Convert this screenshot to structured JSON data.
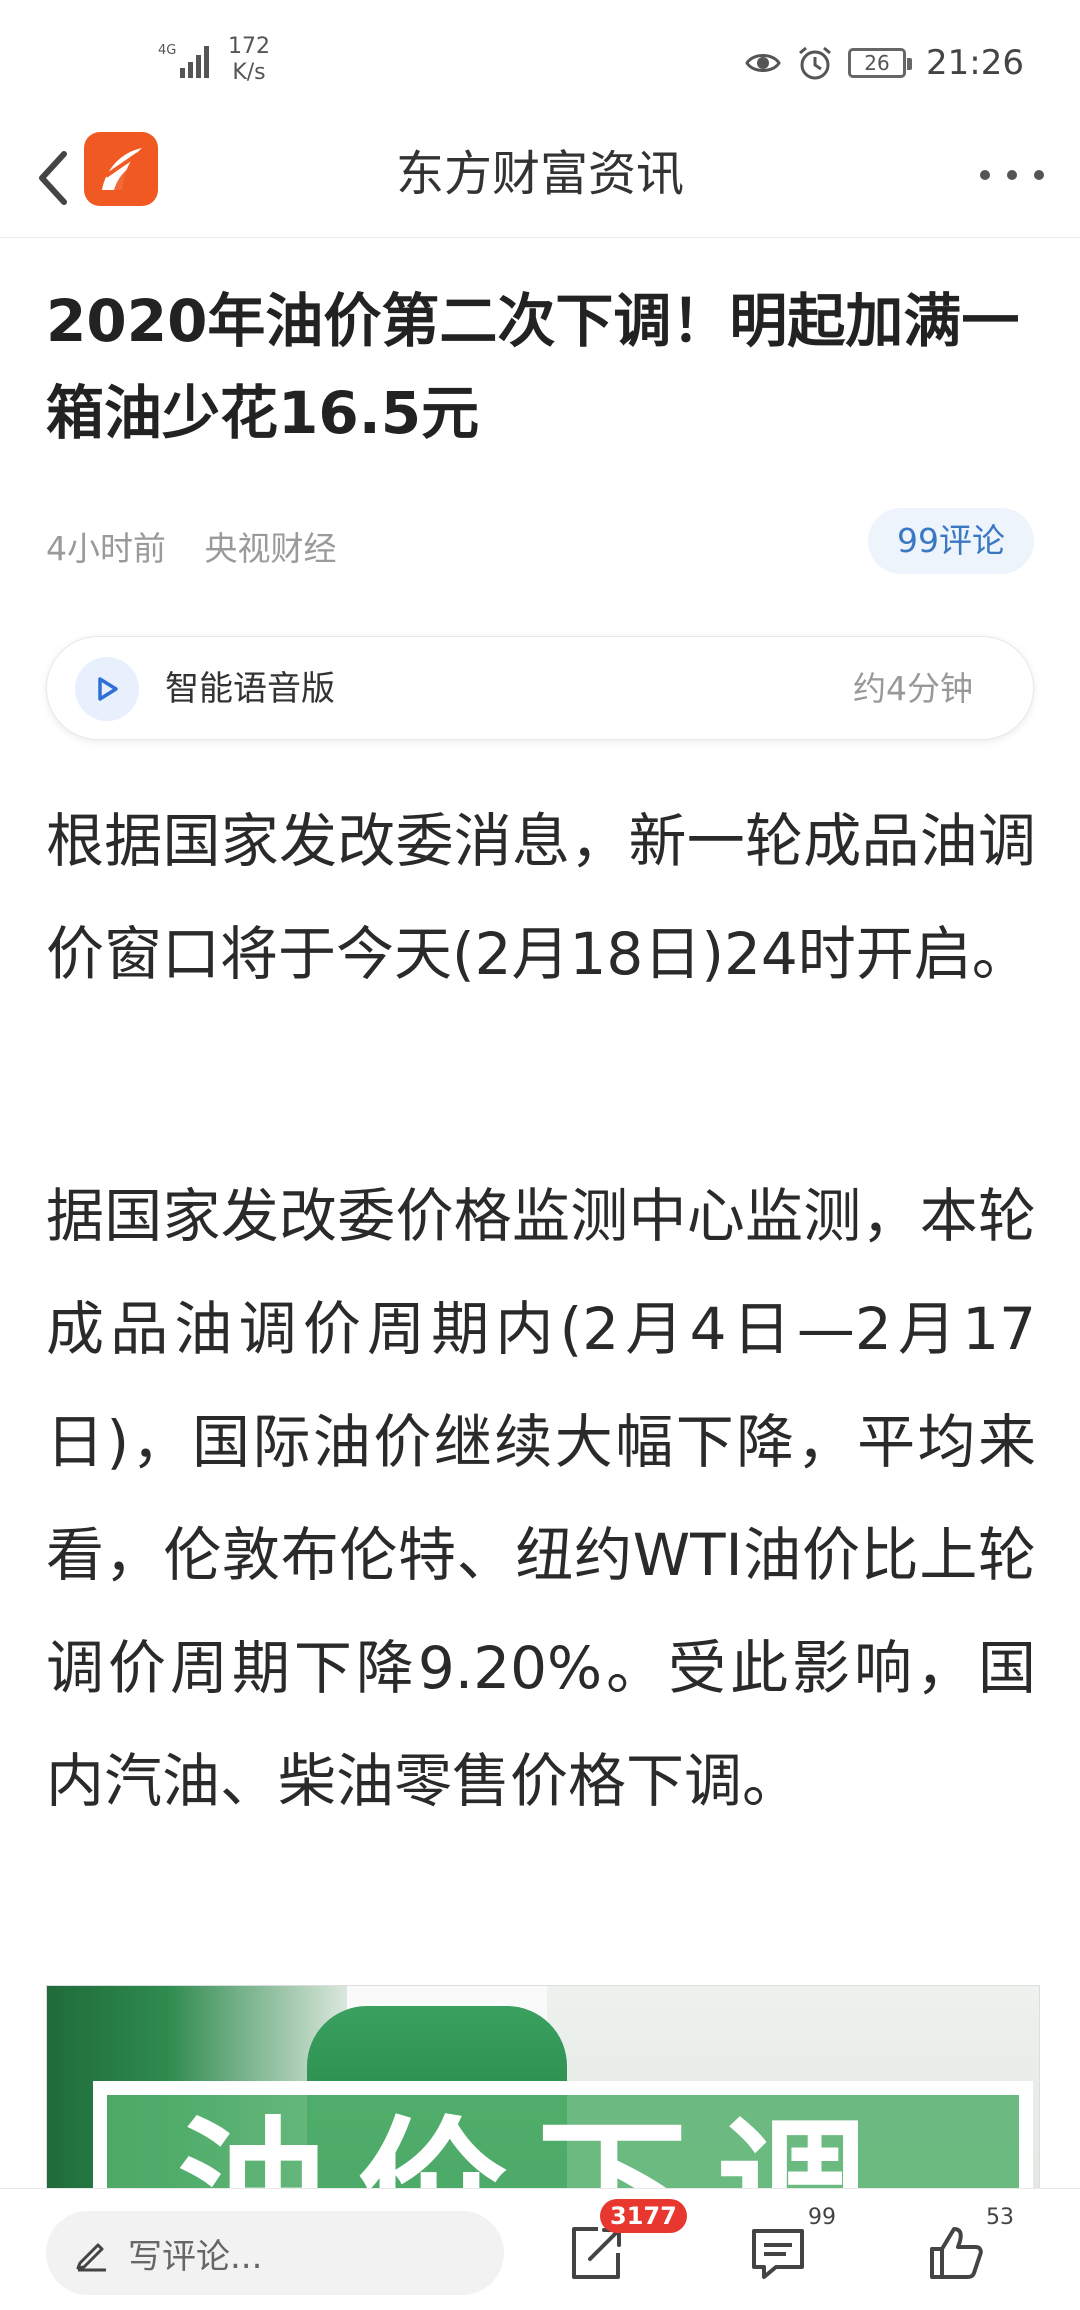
{
  "status_bar": {
    "network": "4G",
    "speed_value": "172",
    "speed_unit": "K/s",
    "battery": "26",
    "time": "21:26"
  },
  "nav": {
    "title": "东方财富资讯",
    "back_icon": "chevron-left-icon",
    "more_icon": "more-dots-icon",
    "logo_color": "#f05a22"
  },
  "article": {
    "title": "2020年油价第二次下调！明起加满一箱油少花16.5元",
    "time_ago": "4小时前",
    "source": "央视财经",
    "comment_pill": "99评论",
    "voice": {
      "label": "智能语音版",
      "duration": "约4分钟"
    },
    "paragraphs": [
      "根据国家发改委消息，新一轮成品油调价窗口将于今天(2月18日)24时开启。",
      "据国家发改委价格监测中心监测，本轮成品油调价周期内(2月4日—2月17日)，国际油价继续大幅下降，平均来看，伦敦布伦特、纽约WTI油价比上轮调价周期下降9.20%。受此影响，国内汽油、柴油零售价格下调。"
    ],
    "image_text": "油价下调"
  },
  "bottom_bar": {
    "comment_placeholder": "写评论...",
    "share_count": "3177",
    "comment_count": "99",
    "like_count": "53"
  }
}
